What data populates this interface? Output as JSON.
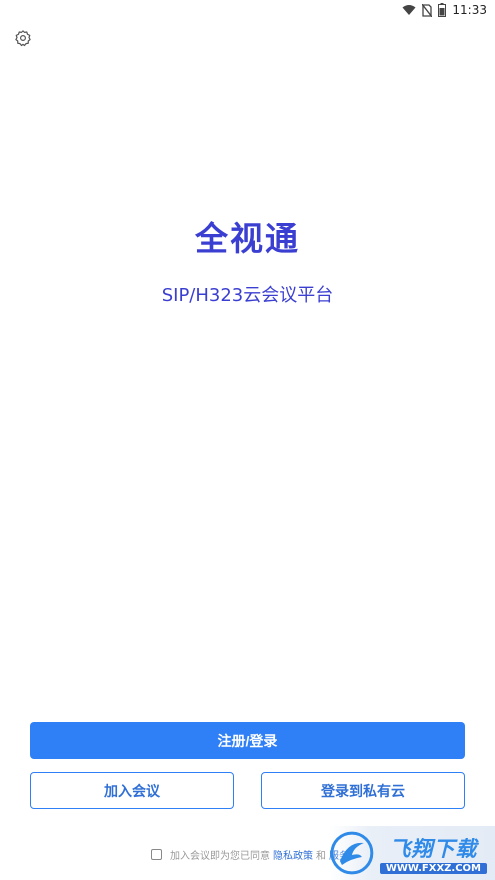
{
  "status_bar": {
    "time": "11:33"
  },
  "app": {
    "title": "全视通",
    "subtitle": "SIP/H323云会议平台"
  },
  "buttons": {
    "register_login": "注册/登录",
    "join_meeting": "加入会议",
    "private_cloud_login": "登录到私有云"
  },
  "agreement": {
    "prefix": "加入会议即为您已同意",
    "privacy_link": "隐私政策",
    "conjunction": "和",
    "terms_link": "服务"
  },
  "watermark": {
    "main": "飞翔下载",
    "sub": "WWW.FXXZ.COM"
  },
  "colors": {
    "brand": "#3b3fd1",
    "primary_button": "#2f7ff6",
    "link": "#2f6fd6"
  },
  "icons": [
    "wifi-icon",
    "no-sim-icon",
    "battery-icon",
    "gear-icon",
    "checkbox-icon"
  ]
}
